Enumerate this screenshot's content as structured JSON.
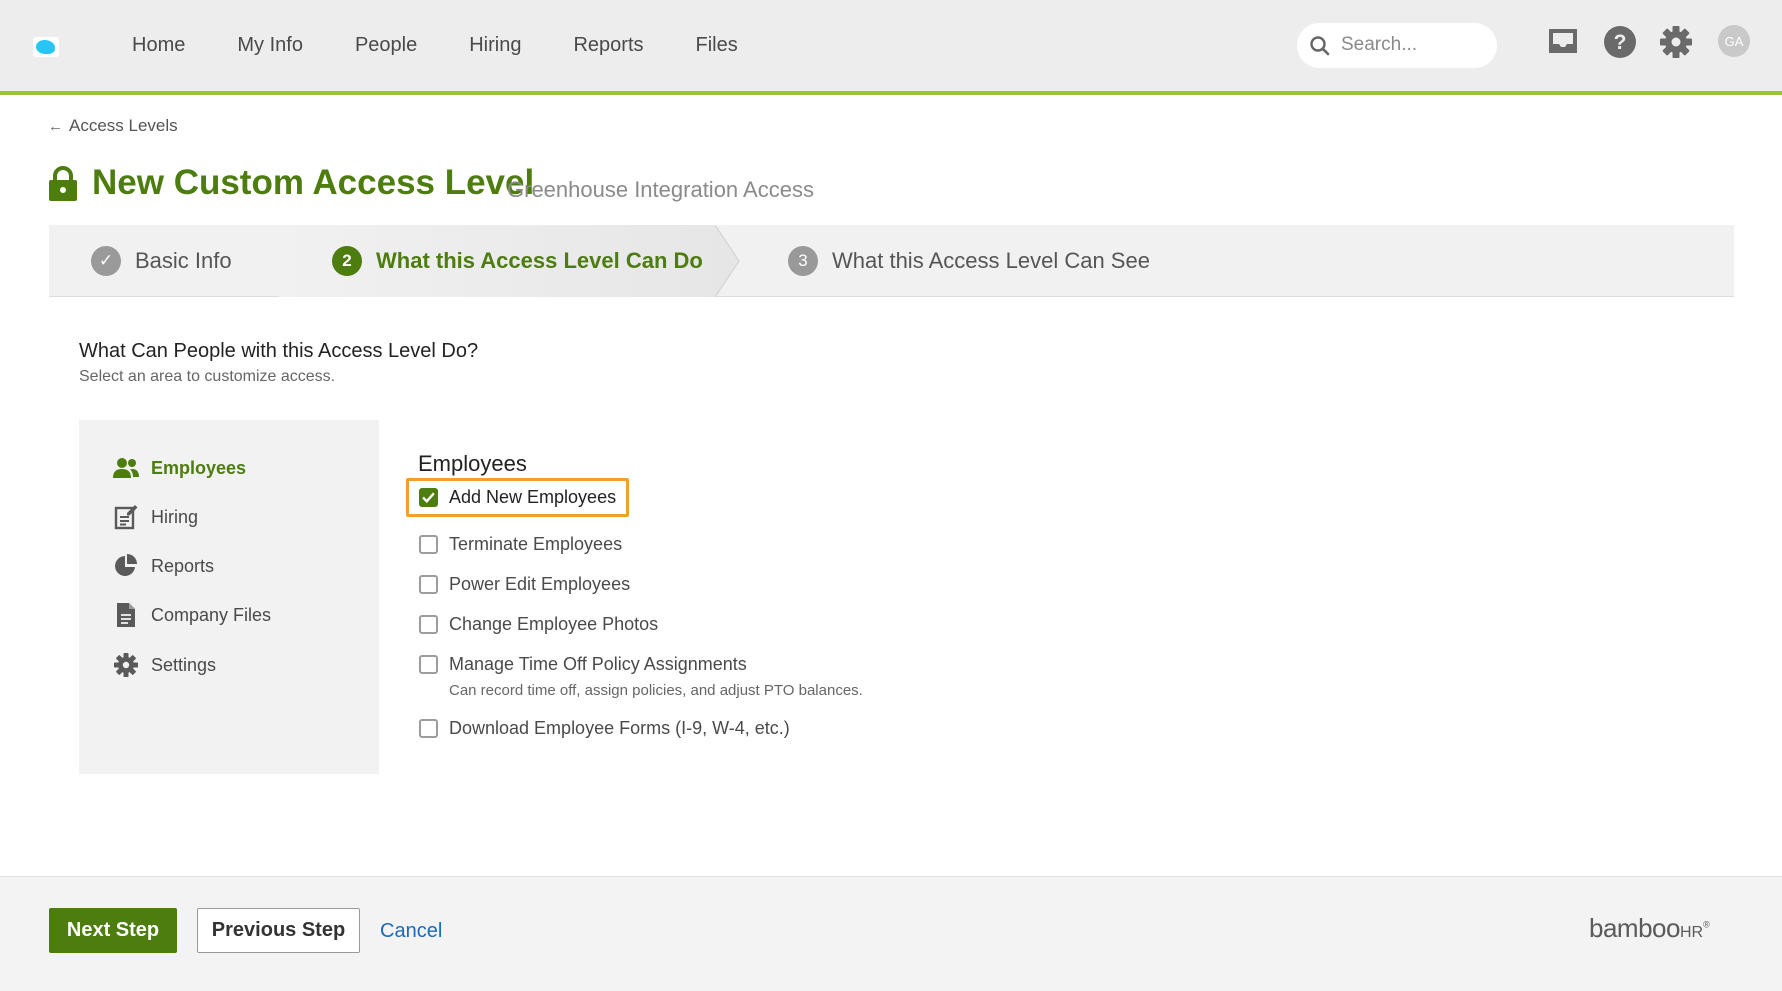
{
  "nav": {
    "items": [
      "Home",
      "My Info",
      "People",
      "Hiring",
      "Reports",
      "Files"
    ]
  },
  "search": {
    "placeholder": "Search..."
  },
  "user": {
    "initials": "GA"
  },
  "breadcrumb": {
    "back_label": "Access Levels"
  },
  "header": {
    "title": "New Custom Access Level",
    "subtitle": "Greenhouse Integration Access"
  },
  "steps": [
    {
      "number": "✓",
      "label": "Basic Info",
      "state": "complete"
    },
    {
      "number": "2",
      "label": "What this Access Level Can Do",
      "state": "active"
    },
    {
      "number": "3",
      "label": "What this Access Level Can See",
      "state": "upcoming"
    }
  ],
  "section": {
    "title": "What Can People with this Access Level Do?",
    "subtitle": "Select an area to customize access."
  },
  "sidebar": {
    "items": [
      {
        "label": "Employees",
        "icon": "people-icon",
        "active": true
      },
      {
        "label": "Hiring",
        "icon": "hiring-icon",
        "active": false
      },
      {
        "label": "Reports",
        "icon": "pie-chart-icon",
        "active": false
      },
      {
        "label": "Company Files",
        "icon": "file-icon",
        "active": false
      },
      {
        "label": "Settings",
        "icon": "gear-icon",
        "active": false
      }
    ]
  },
  "permissions": {
    "title": "Employees",
    "items": [
      {
        "label": "Add New Employees",
        "checked": true
      },
      {
        "label": "Terminate Employees",
        "checked": false
      },
      {
        "label": "Power Edit Employees",
        "checked": false
      },
      {
        "label": "Change Employee Photos",
        "checked": false
      },
      {
        "label": "Manage Time Off Policy Assignments",
        "checked": false,
        "note": "Can record time off, assign policies, and adjust PTO balances."
      },
      {
        "label": "Download Employee Forms (I-9, W-4, etc.)",
        "checked": false
      }
    ]
  },
  "footer": {
    "next_label": "Next Step",
    "previous_label": "Previous Step",
    "cancel_label": "Cancel",
    "brand": "bamboo",
    "brand_suffix": "HR",
    "brand_mark": "®"
  },
  "colors": {
    "brand_green": "#4d7c0f",
    "accent_bar": "#9bc23c",
    "highlight": "#f0a030",
    "link_blue": "#1b6bb8"
  }
}
